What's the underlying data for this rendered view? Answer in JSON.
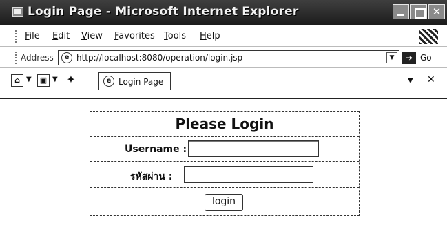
{
  "window": {
    "title": "Login Page - Microsoft Internet Explorer"
  },
  "menu": {
    "items": [
      "File",
      "Edit",
      "View",
      "Favorites",
      "Tools",
      "Help"
    ]
  },
  "address_bar": {
    "label": "Address",
    "url": "http://localhost:8080/operation/login.jsp",
    "go_label": "Go"
  },
  "tabs": [
    {
      "label": "Login Page"
    }
  ],
  "login": {
    "heading": "Please Login",
    "username_label": "Username :",
    "username_value": "",
    "password_label": "รหัสผ่าน :",
    "password_value": "",
    "button_label": "login"
  },
  "icons": {
    "app": "ie-icon",
    "brand": "windows-flag-icon",
    "page": "ie-page-icon",
    "go": "go-arrow-icon"
  }
}
